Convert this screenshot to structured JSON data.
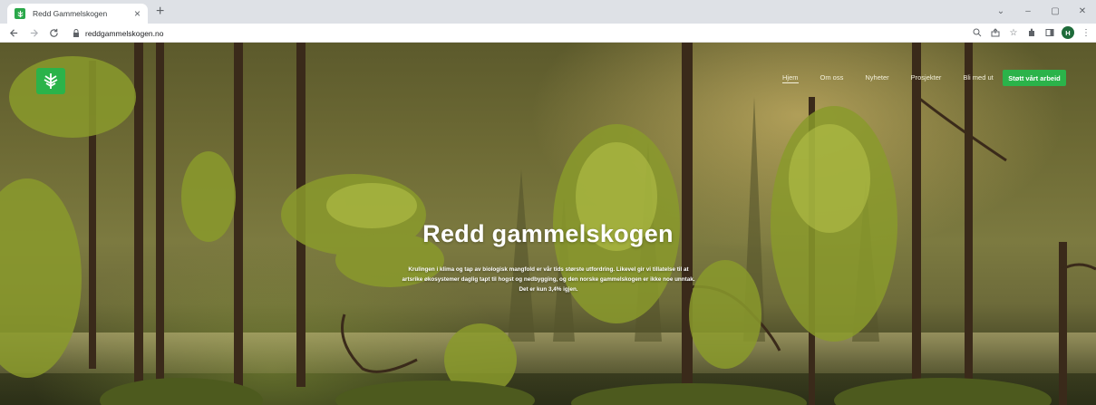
{
  "browser": {
    "tab_title": "Redd Gammelskogen",
    "tab_close": "×",
    "new_tab": "+",
    "url": "reddgammelskogen.no",
    "profile_initial": "H",
    "window_controls": {
      "minimize": "–",
      "maximize": "▢",
      "close": "✕",
      "dropdown": "⌄"
    }
  },
  "site": {
    "nav": [
      {
        "label": "Hjem",
        "active": true
      },
      {
        "label": "Om oss",
        "active": false
      },
      {
        "label": "Nyheter",
        "active": false
      },
      {
        "label": "Prosjekter",
        "active": false
      },
      {
        "label": "Bli med ut",
        "active": false
      }
    ],
    "cta_label": "Støtt vårt arbeid",
    "hero_title": "Redd gammelskogen",
    "hero_text": "Krulingen i klima og tap av biologisk mangfold er vår tids største utfordring. Likevel gir vi tillatelse til at artsrike økosystemer daglig tapt til hogst og nedbygging, og den norske gammelskogen er ikke noe unntak. Det er kun 3,4% igjen."
  },
  "colors": {
    "brand_green": "#2bb34a",
    "tabstrip": "#dee1e6"
  },
  "icons": [
    "back-icon",
    "forward-icon",
    "reload-icon",
    "lock-icon",
    "zoom-icon",
    "share-icon",
    "star-icon",
    "extensions-icon",
    "sidepanel-icon",
    "menu-icon",
    "logo-tree-icon"
  ]
}
